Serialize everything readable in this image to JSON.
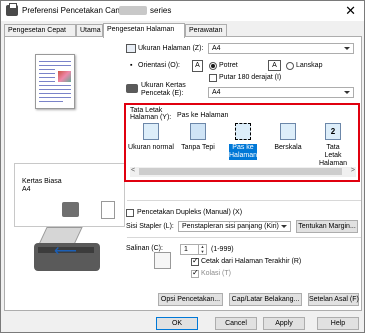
{
  "window": {
    "title": "Preferensi Pencetakan Canon",
    "title_suffix": "series",
    "close_glyph": "✕"
  },
  "tabs": [
    {
      "label": "Pengesetan Cepat"
    },
    {
      "label": "Utama"
    },
    {
      "label": "Pengesetan Halaman"
    },
    {
      "label": "Perawatan"
    }
  ],
  "preview": {
    "media_label": "Kertas Biasa",
    "size_label": "A4"
  },
  "page_settings": {
    "page_size_label": "Ukuran Halaman (Z):",
    "page_size_value": "A4",
    "orientation_label": "Orientasi (O):",
    "portrait_label": "Potret",
    "landscape_label": "Lanskap",
    "rotate_label": "Putar 180 derajat (I)",
    "printer_paper_label_1": "Ukuran Kertas",
    "printer_paper_label_2": "Pencetak (E):",
    "printer_paper_value": "A4"
  },
  "layout": {
    "label_1": "Tata Letak",
    "label_2": "Halaman (Y):",
    "selected_name": "Pas ke Halaman",
    "items": [
      {
        "name": "Ukuran normal"
      },
      {
        "name": "Tanpa Tepi"
      },
      {
        "name": "Pas ke Halaman"
      },
      {
        "name": "Berskala"
      },
      {
        "name": "Tata Letak Halaman",
        "badge": "2"
      }
    ]
  },
  "duplex": {
    "label": "Pencetakan Dupleks (Manual) (X)",
    "stapler_label": "Sisi Stapler (L):",
    "stapler_value": "Penstapleran sisi panjang (Kiri)",
    "margin_button": "Tentukan Margin..."
  },
  "copies": {
    "label": "Salinan (C):",
    "value": "1",
    "range": "(1-999)",
    "print_last_label": "Cetak dari Halaman Terakhir (R)",
    "collate_label": "Kolasi (T)"
  },
  "bottom_buttons": {
    "options": "Opsi Pencetakan...",
    "stamp": "Cap/Latar Belakang...",
    "defaults": "Setelan Asal (F)"
  },
  "footer": {
    "ok": "OK",
    "cancel": "Cancel",
    "apply": "Apply",
    "help": "Help"
  },
  "colors": {
    "highlight_border": "#e0000f",
    "selection": "#0078d7"
  }
}
